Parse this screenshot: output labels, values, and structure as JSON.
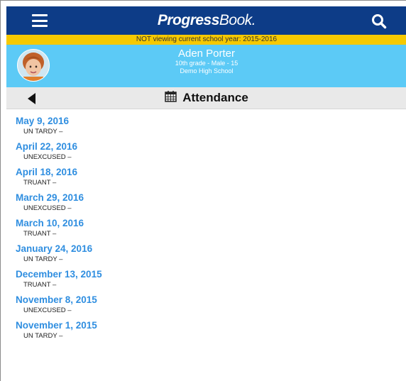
{
  "app": {
    "brand_part1": "Progress",
    "brand_part2": "Book."
  },
  "banner": {
    "text": "NOT viewing current school year: 2015-2016"
  },
  "student": {
    "name": "Aden Porter",
    "info": "10th grade - Male - 15",
    "school": "Demo High School"
  },
  "page": {
    "title": "Attendance"
  },
  "attendance": [
    {
      "date": "May 9, 2016",
      "type": "UN TARDY –"
    },
    {
      "date": "April 22, 2016",
      "type": "UNEXCUSED –"
    },
    {
      "date": "April 18, 2016",
      "type": "TRUANT –"
    },
    {
      "date": "March 29, 2016",
      "type": "UNEXCUSED –"
    },
    {
      "date": "March 10, 2016",
      "type": "TRUANT –"
    },
    {
      "date": "January 24, 2016",
      "type": "UN TARDY –"
    },
    {
      "date": "December 13, 2015",
      "type": "TRUANT –"
    },
    {
      "date": "November 8, 2015",
      "type": "UNEXCUSED –"
    },
    {
      "date": "November 1, 2015",
      "type": "UN TARDY –"
    }
  ],
  "icons": {
    "menu": "hamburger-menu-icon",
    "search": "search-icon",
    "back": "back-arrow-icon",
    "calendar": "calendar-icon"
  },
  "colors": {
    "topbar": "#0d3c87",
    "banner": "#f6c900",
    "student_header": "#5ccaf6",
    "date_link": "#2f8ee0"
  }
}
